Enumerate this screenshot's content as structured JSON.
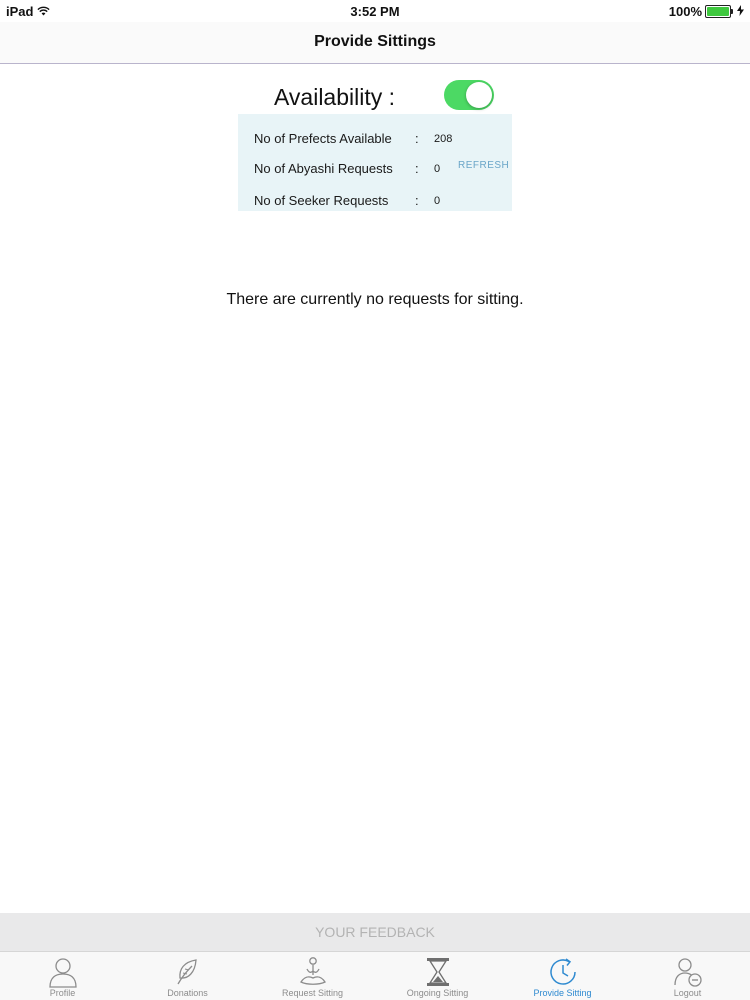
{
  "status_bar": {
    "device": "iPad",
    "time": "3:52 PM",
    "battery": "100%",
    "wifi_icon": "wifi-icon",
    "battery_icon": "battery-icon",
    "charging_icon": "charging-bolt-icon"
  },
  "nav": {
    "title": "Provide Sittings"
  },
  "availability": {
    "label": "Availability :",
    "enabled": true,
    "toggle_color": "#4cd964"
  },
  "stats": {
    "prefects_label": "No of Prefects Available",
    "prefects_value": "208",
    "abyashi_label": "No of Abyashi Requests",
    "abyashi_value": "0",
    "seeker_label": "No of Seeker Requests",
    "seeker_value": "0",
    "colon": ":",
    "refresh_label": "REFRESH",
    "panel_color": "#e8f4f7"
  },
  "empty_message": "There are currently no requests for sitting.",
  "feedback": {
    "label": "YOUR FEEDBACK"
  },
  "tabs": [
    {
      "label": "Profile",
      "icon": "user-icon",
      "active": false
    },
    {
      "label": "Donations",
      "icon": "leaf-icon",
      "active": false
    },
    {
      "label": "Request Sitting",
      "icon": "meditation-icon",
      "active": false
    },
    {
      "label": "Ongoing Sitting",
      "icon": "hourglass-icon",
      "active": false
    },
    {
      "label": "Provide Sitting",
      "icon": "clock-icon",
      "active": true
    },
    {
      "label": "Logout",
      "icon": "logout-user-icon",
      "active": false
    }
  ],
  "colors": {
    "accent": "#2f8ad0",
    "toggle_on": "#4cd964",
    "inactive_tab": "#8c8c8c"
  }
}
